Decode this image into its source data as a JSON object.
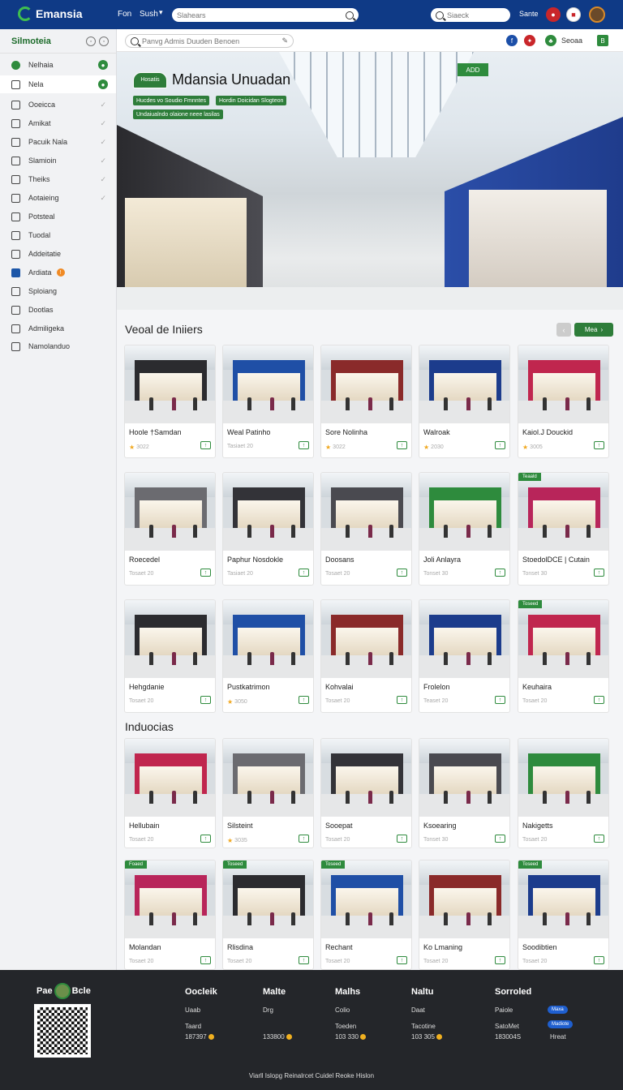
{
  "topbar": {
    "brand": "Emansia",
    "links": [
      "Fon",
      "Sush"
    ],
    "search_placeholder": "Slahears",
    "search2_placeholder": "Siaeck",
    "right_label": "Sante",
    "icons": [
      "notification-icon",
      "flag-icon",
      "user-avatar"
    ]
  },
  "sidebar": {
    "title": "Silmoteia",
    "items": [
      {
        "label": "Nelhaia",
        "icon": "green-dot-icon",
        "status": "green"
      },
      {
        "label": "Nela",
        "icon": "home-icon",
        "status": "green",
        "active": true
      },
      {
        "label": "Ooeicca",
        "icon": "key-icon",
        "status": "check"
      },
      {
        "label": "Amikat",
        "icon": "document-icon",
        "status": "check"
      },
      {
        "label": "Pacuik Nala",
        "icon": "lock-icon",
        "status": "check"
      },
      {
        "label": "Slamioin",
        "icon": "document-icon",
        "status": "check"
      },
      {
        "label": "Theiks",
        "icon": "list-icon",
        "status": "check"
      },
      {
        "label": "Aotaieing",
        "icon": "circle-icon",
        "status": "check"
      },
      {
        "label": "Potsteal",
        "icon": "chat-icon",
        "status": ""
      },
      {
        "label": "Tuodal",
        "icon": "file-icon",
        "status": ""
      },
      {
        "label": "Addeitatie",
        "icon": "image-icon",
        "status": ""
      },
      {
        "label": "Ardiata",
        "icon": "blue-square-icon",
        "status": "",
        "badge": "!"
      },
      {
        "label": "Sploiang",
        "icon": "grid-icon",
        "status": ""
      },
      {
        "label": "Dootlas",
        "icon": "box-icon",
        "status": ""
      },
      {
        "label": "Admiligeka",
        "icon": "folder-icon",
        "status": ""
      },
      {
        "label": "Namolanduo",
        "icon": "clip-icon",
        "status": ""
      }
    ]
  },
  "subbar": {
    "search_placeholder": "Panvg Admis Duuden Benoen",
    "right_label": "Seoaa"
  },
  "hero": {
    "badge": "Hosatis",
    "title": "Mdansia Unuadan",
    "tags": [
      "Hucdes vo Soudio Fmnntes",
      "Hordin Doicidan Slogteon",
      "Undaiualndo olaione neee lasilas"
    ],
    "sign": "ADD"
  },
  "section1": {
    "title": "Veoal de Iniiers",
    "next_label": "Mea",
    "cards": [
      {
        "name": "Hoole †Samdan",
        "meta": "3022",
        "star": true
      },
      {
        "name": "Weal Patinho",
        "meta": "Tasiaet 20",
        "star": false
      },
      {
        "name": "Sore Nolinha",
        "meta": "3022",
        "star": true
      },
      {
        "name": "Walroak",
        "meta": "2030",
        "star": true
      },
      {
        "name": "Kaiol.J Douckid",
        "meta": "3005",
        "star": true
      },
      {
        "name": "Roecedel",
        "meta": "Tosaet 20",
        "star": false
      },
      {
        "name": "Paphur Nosdokle",
        "meta": "Tasiaet 20",
        "star": false
      },
      {
        "name": "Doosans",
        "meta": "Tosaet 20",
        "star": false
      },
      {
        "name": "Joli Anlayra",
        "meta": "Tonset 30",
        "star": false
      },
      {
        "name": "StoedolDCE | Cutain",
        "meta": "Tonset 30",
        "star": false,
        "corner": "Teaald"
      },
      {
        "name": "Hehgdanie",
        "meta": "Tosaet 20",
        "star": false
      },
      {
        "name": "Pustkatrimon",
        "meta": "3050",
        "star": true
      },
      {
        "name": "Kohvalai",
        "meta": "Tosaet 20",
        "star": false
      },
      {
        "name": "Frolelon",
        "meta": "Teaset 20",
        "star": false
      },
      {
        "name": "Keuhaira",
        "meta": "Tosaet 20",
        "star": false,
        "corner": "Toseed"
      }
    ]
  },
  "section2": {
    "title": "Induocias",
    "cards": [
      {
        "name": "Hellubain",
        "meta": "Tosaet 20",
        "star": false
      },
      {
        "name": "Silsteint",
        "meta": "3035",
        "star": true
      },
      {
        "name": "Sooepat",
        "meta": "Tosaet 20",
        "star": false
      },
      {
        "name": "Ksoearing",
        "meta": "Tonset 30",
        "star": false
      },
      {
        "name": "Nakigetts",
        "meta": "Tosaet 20",
        "star": false
      },
      {
        "name": "Molandan",
        "meta": "Tosaet 20",
        "star": false,
        "corner": "Foaed"
      },
      {
        "name": "Rlisdina",
        "meta": "Tosaet 20",
        "star": false,
        "corner": "Toseed"
      },
      {
        "name": "Rechant",
        "meta": "Tosaet 20",
        "star": false,
        "corner": "Toseed"
      },
      {
        "name": "Ko Lmaning",
        "meta": "Tosaet 20",
        "star": false
      },
      {
        "name": "Soodibtien",
        "meta": "Tosaet 20",
        "star": false,
        "corner": "Toseed"
      }
    ]
  },
  "footer": {
    "brand_left": "Pae",
    "brand_right": "Bcle",
    "columns": [
      {
        "title": "Oocleik",
        "line1": "Uaab",
        "line2": "Taard",
        "value": "187397"
      },
      {
        "title": "Malte",
        "line1": "Drg",
        "line2": "",
        "value": "133800"
      },
      {
        "title": "Malhs",
        "line1": "Colio",
        "line2": "Toeden",
        "value": "103 330"
      },
      {
        "title": "Naltu",
        "line1": "Daat",
        "line2": "Tacotine",
        "value": "103 305"
      },
      {
        "title": "Sorroled",
        "line1": "Paiole",
        "line2": "SatoMet",
        "value": "183004S"
      }
    ],
    "pill1": "Maxa",
    "pill2": "Madiote",
    "extra": "Hreat",
    "bottom": "Viarll Islopg  Reinalrcet Cuidel  Reoke Hislon"
  },
  "colors": {
    "brand_blue": "#0f3a86",
    "accent_green": "#2e7d3a",
    "footer": "#24262a"
  }
}
